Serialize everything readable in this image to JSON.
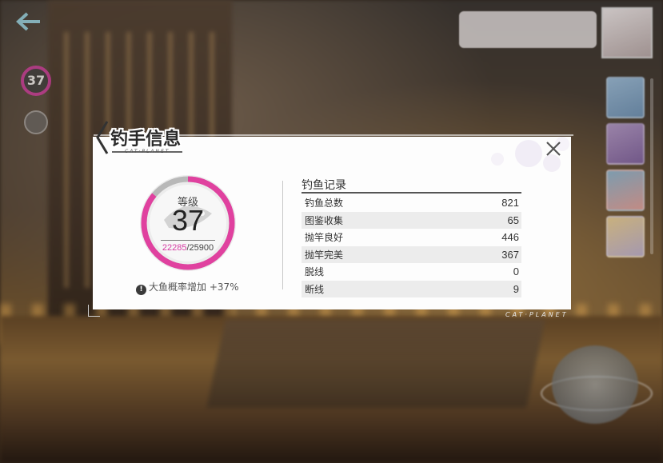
{
  "dialog": {
    "title": "钓手信息",
    "brand": "CAT·PLANET",
    "close_icon": "close-icon",
    "level": {
      "label": "等级",
      "value": "37",
      "xp_current": "22285",
      "xp_separator": "/",
      "xp_total": "25900",
      "progress_fraction": 0.86,
      "ring_color": "#e0419f"
    },
    "bonus": {
      "icon": "exclamation-icon",
      "text": "大鱼概率增加 +37%"
    },
    "records": {
      "title": "钓鱼记录",
      "rows": [
        {
          "label": "钓鱼总数",
          "value": "821"
        },
        {
          "label": "图鉴收集",
          "value": "65"
        },
        {
          "label": "抛竿良好",
          "value": "446"
        },
        {
          "label": "抛竿完美",
          "value": "367"
        },
        {
          "label": "脱线",
          "value": "0"
        },
        {
          "label": "断线",
          "value": "9"
        }
      ]
    }
  },
  "hud": {
    "back_icon": "back-arrow-icon",
    "level_value": "37"
  }
}
